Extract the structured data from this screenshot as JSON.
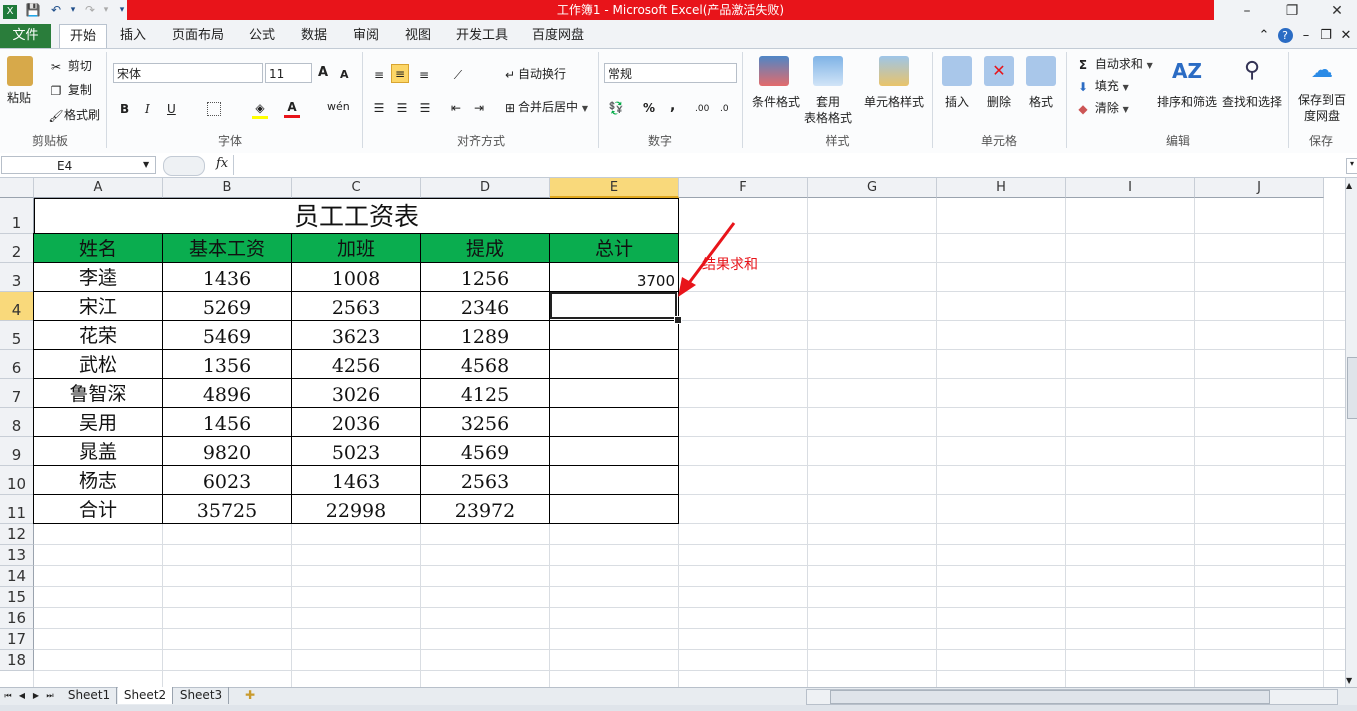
{
  "window": {
    "title": "工作簿1 - Microsoft Excel(产品激活失败)",
    "qa_save": "💾",
    "qa_undo": "↶",
    "qa_redo": "↷",
    "qa_more": "▾",
    "min": "–",
    "restore": "❐",
    "close": "✕"
  },
  "tabs": [
    "文件",
    "开始",
    "插入",
    "页面布局",
    "公式",
    "数据",
    "审阅",
    "视图",
    "开发工具",
    "百度网盘"
  ],
  "active_tab": "开始",
  "right_icons": {
    "up": "⌃",
    "help": "?",
    "min": "–",
    "restore": "❐",
    "close": "✕"
  },
  "ribbon": {
    "clipboard": {
      "label": "剪贴板",
      "paste": "粘贴",
      "cut": "剪切",
      "copy": "复制",
      "painter": "格式刷"
    },
    "font": {
      "label": "字体",
      "name": "宋体",
      "size": "11",
      "grow": "A",
      "shrink": "A",
      "bold": "B",
      "italic": "I",
      "underline": "U",
      "wen": "wén"
    },
    "alignment": {
      "label": "对齐方式",
      "wrap": "自动换行",
      "merge": "合并后居中"
    },
    "number": {
      "label": "数字",
      "format": "常规",
      "percent": "%",
      "comma": ",",
      "inc": ".00",
      "dec": ".0"
    },
    "styles": {
      "label": "样式",
      "cond": "条件格式",
      "table1": "套用",
      "table2": "表格格式",
      "cell": "单元格样式"
    },
    "cells": {
      "label": "单元格",
      "insert": "插入",
      "delete": "删除",
      "format": "格式"
    },
    "editing": {
      "label": "编辑",
      "autosum": "自动求和",
      "fill": "填充",
      "clear": "清除",
      "sort": "排序和筛选",
      "find": "查找和选择",
      "sigma": "Σ"
    },
    "save": {
      "label": "保存",
      "save1": "保存到百",
      "save2": "度网盘"
    }
  },
  "formula_bar": {
    "name_box": "E4",
    "fx": "fx",
    "formula": ""
  },
  "columns": [
    "A",
    "B",
    "C",
    "D",
    "E",
    "F",
    "G",
    "H",
    "I",
    "J"
  ],
  "selected_column": "E",
  "rows": [
    "1",
    "2",
    "3",
    "4",
    "5",
    "6",
    "7",
    "8",
    "9",
    "10",
    "11",
    "12",
    "13",
    "14",
    "15",
    "16",
    "17",
    "18"
  ],
  "selected_row": "4",
  "sheet": {
    "title": "员工工资表",
    "headers": [
      "姓名",
      "基本工资",
      "加班",
      "提成",
      "总计"
    ],
    "data": [
      [
        "李逵",
        "1436",
        "1008",
        "1256",
        "3700"
      ],
      [
        "宋江",
        "5269",
        "2563",
        "2346",
        ""
      ],
      [
        "花荣",
        "5469",
        "3623",
        "1289",
        ""
      ],
      [
        "武松",
        "1356",
        "4256",
        "4568",
        ""
      ],
      [
        "鲁智深",
        "4896",
        "3026",
        "4125",
        ""
      ],
      [
        "吴用",
        "1456",
        "2036",
        "3256",
        ""
      ],
      [
        "晁盖",
        "9820",
        "5023",
        "4569",
        ""
      ],
      [
        "杨志",
        "6023",
        "1463",
        "2563",
        ""
      ],
      [
        "合计",
        "35725",
        "22998",
        "23972",
        ""
      ]
    ],
    "header_color": "#0aad4f"
  },
  "annotation": {
    "text": "结果求和",
    "color": "#e8141a"
  },
  "sheet_tabs": [
    "Sheet1",
    "Sheet2",
    "Sheet3"
  ],
  "active_sheet": "Sheet2",
  "nav": {
    "first": "⏮",
    "prev": "◀",
    "next": "▶",
    "last": "⏭"
  }
}
